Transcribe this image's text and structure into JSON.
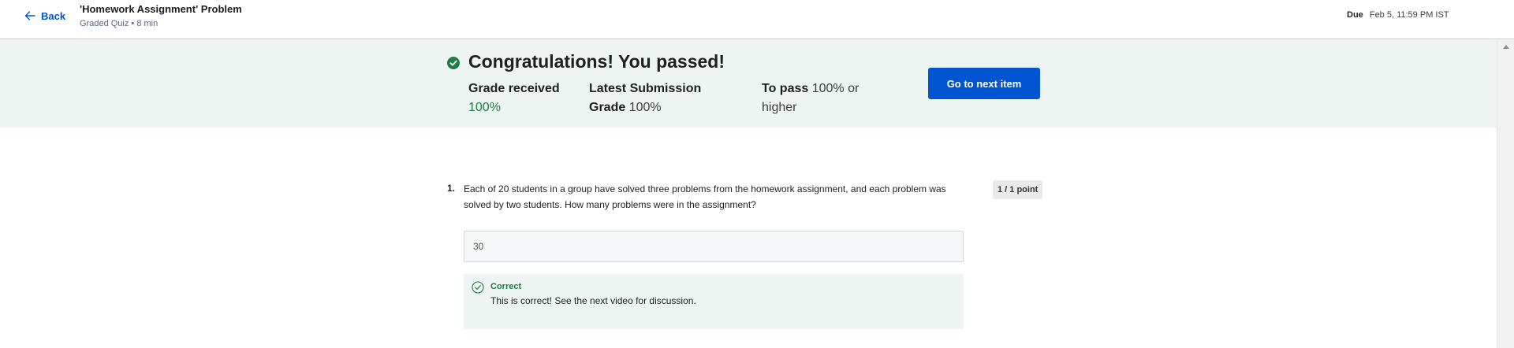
{
  "header": {
    "back_label": "Back",
    "title": "'Homework Assignment' Problem",
    "subtitle": "Graded Quiz • 8 min",
    "due_label": "Due",
    "due_value": "Feb 5, 11:59 PM IST"
  },
  "banner": {
    "heading": "Congratulations! You passed!",
    "grade_received_label": "Grade received",
    "grade_received_value": "100%",
    "latest_submission_label": "Latest Submission Grade",
    "latest_submission_value": "100%",
    "to_pass_label": "To pass",
    "to_pass_value": "100% or higher",
    "next_button_label": "Go to next item",
    "colors": {
      "success_green": "#1e7d45",
      "banner_bg": "#eef4f2",
      "primary_blue": "#0056d2"
    }
  },
  "question": {
    "number": "1.",
    "text": "Each of 20 students in a group have solved three problems from the homework assignment, and each problem was solved by two students. How many problems were in the assignment?",
    "points": "1 / 1 point",
    "answer_value": "30",
    "feedback_title": "Correct",
    "feedback_text": "This is correct! See the next video for discussion."
  },
  "icons": {
    "back": "arrow-left-icon",
    "banner": "check-circle-filled-icon",
    "feedback": "check-circle-outline-icon"
  }
}
